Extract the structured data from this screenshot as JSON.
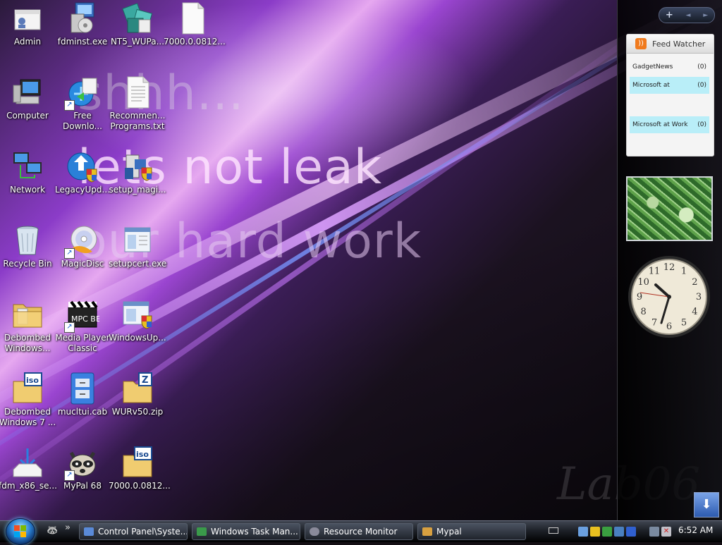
{
  "wallpaper": {
    "line1": "shhh...",
    "line2": "lets not leak",
    "line3": "our hard work",
    "watermark": "Lab06"
  },
  "icons": [
    {
      "name": "admin",
      "label": "Admin",
      "icon": "user-folder-icon"
    },
    {
      "name": "fdminst",
      "label": "fdminst.exe",
      "icon": "installer-icon"
    },
    {
      "name": "nt5-wupa",
      "label": "NT5_WUPa...",
      "icon": "installer-icon"
    },
    {
      "name": "7000-file",
      "label": "7000.0.0812...",
      "icon": "blank-file-icon"
    },
    {
      "name": "computer",
      "label": "Computer",
      "icon": "computer-icon"
    },
    {
      "name": "free-download",
      "label": "Free Downlo...",
      "icon": "ie-shortcut-icon"
    },
    {
      "name": "recommended-programs",
      "label": "Recommen... Programs.txt",
      "icon": "text-file-icon"
    },
    {
      "name": "network",
      "label": "Network",
      "icon": "network-icon"
    },
    {
      "name": "legacy-update",
      "label": "LegacyUpd...",
      "icon": "globe-shield-icon"
    },
    {
      "name": "setup-magic",
      "label": "setup_magi...",
      "icon": "setup-icon"
    },
    {
      "name": "recycle-bin",
      "label": "Recycle Bin",
      "icon": "recycle-bin-icon"
    },
    {
      "name": "magicdisc",
      "label": "MagicDisc",
      "icon": "disc-icon"
    },
    {
      "name": "setupcert",
      "label": "setupcert.exe",
      "icon": "window-app-icon"
    },
    {
      "name": "debombed-windows",
      "label": "Debombed Windows...",
      "icon": "folder-icon"
    },
    {
      "name": "media-player-classic",
      "label": "Media Player Classic",
      "icon": "clapperboard-icon"
    },
    {
      "name": "windows-update",
      "label": "WindowsUp...",
      "icon": "window-shield-icon"
    },
    {
      "name": "debombed-windows-7",
      "label": "Debombed Windows 7 ...",
      "icon": "iso-file-icon"
    },
    {
      "name": "mucltui",
      "label": "mucltui.cab",
      "icon": "cabinet-icon"
    },
    {
      "name": "wurv50",
      "label": "WURv50.zip",
      "icon": "zip-folder-icon"
    },
    {
      "name": "fdm-x86",
      "label": "fdm_x86_se...",
      "icon": "download-icon"
    },
    {
      "name": "mypal-68",
      "label": "MyPal 68",
      "icon": "raccoon-icon"
    },
    {
      "name": "7000-iso",
      "label": "7000.0.0812...",
      "icon": "iso-file-icon"
    }
  ],
  "sidebar": {
    "add": "+",
    "prev": "◄",
    "next": "►",
    "feed": {
      "title": "Feed Watcher",
      "rows": [
        {
          "label": "GadgetNews",
          "count": "(0)"
        },
        {
          "label": "Microsoft at",
          "count": "(0)"
        },
        {
          "label": "Microsoft at Work",
          "count": "(0)"
        }
      ]
    },
    "clock_numerals": [
      "12",
      "1",
      "2",
      "3",
      "4",
      "5",
      "6",
      "7",
      "8",
      "9",
      "10",
      "11"
    ]
  },
  "taskbar": {
    "quicklaunch_more": "»",
    "tasks": [
      {
        "label": "Control Panel\\Syste...",
        "color": "#5a8ad8"
      },
      {
        "label": "Windows Task Man...",
        "color": "#3a9a4a"
      },
      {
        "label": "Resource Monitor",
        "color": "#8a8a9a"
      },
      {
        "label": "Mypal",
        "color": "#d8a040"
      }
    ],
    "time": "6:52 AM"
  },
  "show_desktop": "⬇"
}
